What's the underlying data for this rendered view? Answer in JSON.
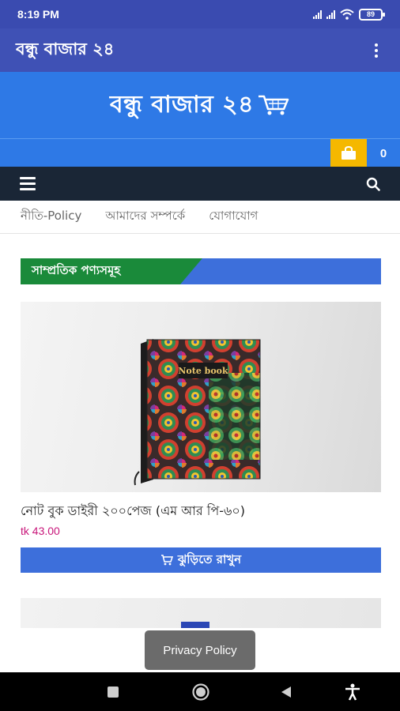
{
  "status_bar": {
    "time": "8:19 PM",
    "battery": "89"
  },
  "app_bar": {
    "title": "বন্ধু বাজার ২৪"
  },
  "header": {
    "logo_text": "বন্ধু বাজার ২৪"
  },
  "cart": {
    "count": "0"
  },
  "menu": {
    "items": [
      "নীতি-Policy",
      "আমাদের সম্পর্কে",
      "যোগাযোগ"
    ]
  },
  "section": {
    "title": "সাম্প্রতিক পণ্যসমূহ"
  },
  "products": [
    {
      "name": "নোট বুক ডাইরী ২০০পেজ (এম আর পি-৬০)",
      "price": "tk 43.00",
      "button": "ঝুড়িতে রাখুন",
      "cover_text": "Note book"
    }
  ],
  "toast": {
    "text": "Privacy Policy"
  },
  "colors": {
    "app_bar": "#3f51b5",
    "banner": "#2e79e6",
    "nav_dark": "#1a2636",
    "cart_accent": "#f5b800",
    "section_green": "#1a8a3a",
    "price": "#c8167a"
  },
  "icons": [
    "signal-icon",
    "wifi-icon",
    "battery-icon",
    "more-vert-icon",
    "shopping-cart-icon",
    "shopping-bag-icon",
    "menu-icon",
    "search-icon",
    "add-to-cart-icon",
    "recent-apps-icon",
    "home-icon",
    "back-icon",
    "accessibility-icon"
  ]
}
